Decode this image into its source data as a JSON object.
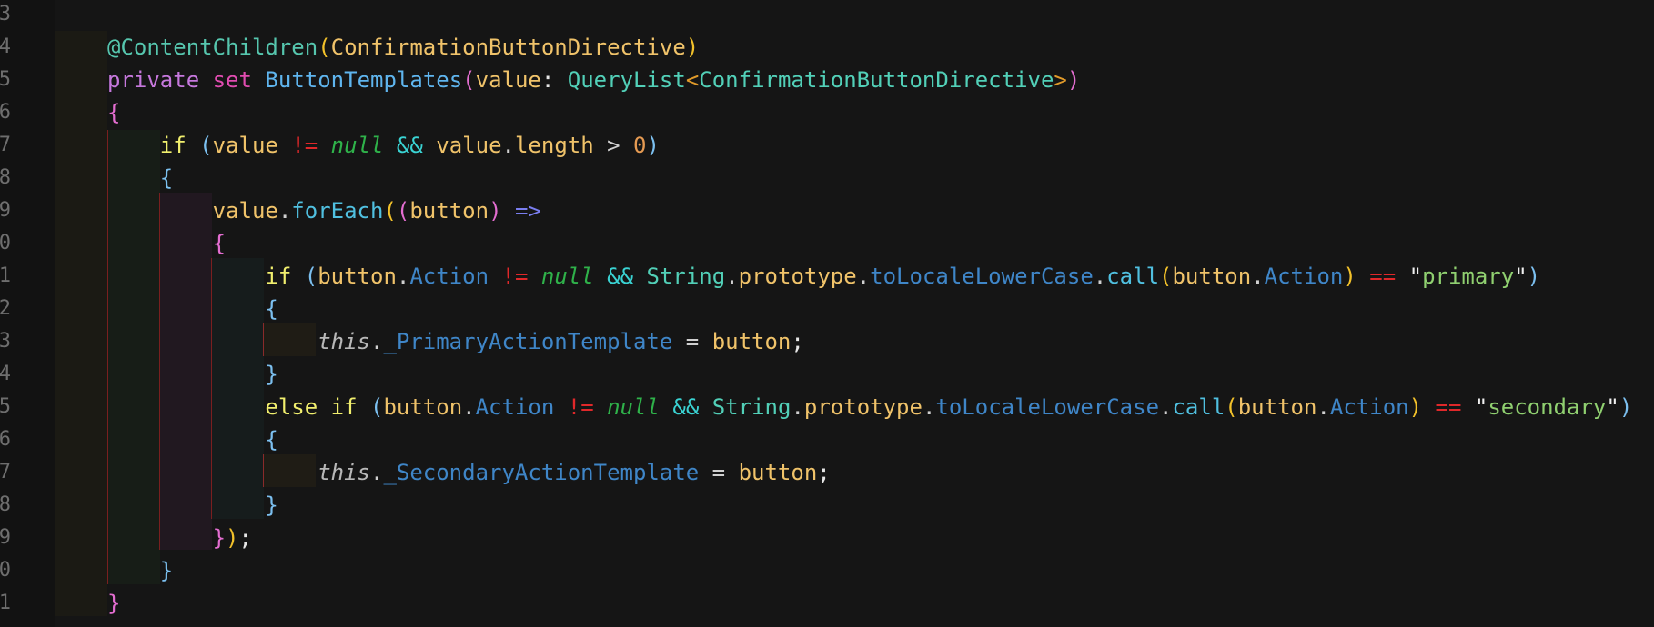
{
  "editor": {
    "line_numbers": [
      "3",
      "4",
      "5",
      "6",
      "7",
      "8",
      "9",
      "0",
      "1",
      "2",
      "3",
      "4",
      "5",
      "6",
      "7",
      "8",
      "9",
      "0",
      "1"
    ],
    "colors": {
      "background": "#151515",
      "keyword": "#c678dd",
      "string": "#90d070",
      "null_literal": "#2fb24a",
      "not_equal": "#e0282a"
    },
    "lines": [
      [],
      [
        {
          "t": "@ContentChildren",
          "c": "c-dec"
        },
        {
          "t": "(",
          "c": "c-br2"
        },
        {
          "t": "ConfirmationButtonDirective",
          "c": "c-var"
        },
        {
          "t": ")",
          "c": "c-br2"
        }
      ],
      [
        {
          "t": "private",
          "c": "c-kw"
        },
        {
          "t": " ",
          "c": "c-plain"
        },
        {
          "t": "set",
          "c": "c-kw2"
        },
        {
          "t": " ",
          "c": "c-plain"
        },
        {
          "t": "ButtonTemplates",
          "c": "c-fn"
        },
        {
          "t": "(",
          "c": "c-br0"
        },
        {
          "t": "value",
          "c": "c-var"
        },
        {
          "t": ": ",
          "c": "c-plain"
        },
        {
          "t": "QueryList",
          "c": "c-type"
        },
        {
          "t": "<",
          "c": "c-pn"
        },
        {
          "t": "ConfirmationButtonDirective",
          "c": "c-type"
        },
        {
          "t": ">",
          "c": "c-pn"
        },
        {
          "t": ")",
          "c": "c-br0"
        }
      ],
      [
        {
          "t": "{",
          "c": "c-br0"
        }
      ],
      [
        {
          "t": "    ",
          "c": "c-plain"
        },
        {
          "t": "if",
          "c": "c-ctl"
        },
        {
          "t": " ",
          "c": "c-plain"
        },
        {
          "t": "(",
          "c": "c-br1"
        },
        {
          "t": "value",
          "c": "c-var"
        },
        {
          "t": " ",
          "c": "c-plain"
        },
        {
          "t": "!=",
          "c": "c-neq"
        },
        {
          "t": " ",
          "c": "c-plain"
        },
        {
          "t": "null",
          "c": "c-null"
        },
        {
          "t": " ",
          "c": "c-plain"
        },
        {
          "t": "&&",
          "c": "c-and"
        },
        {
          "t": " ",
          "c": "c-plain"
        },
        {
          "t": "value",
          "c": "c-var"
        },
        {
          "t": ".",
          "c": "c-op"
        },
        {
          "t": "length",
          "c": "c-var"
        },
        {
          "t": " ",
          "c": "c-plain"
        },
        {
          "t": ">",
          "c": "c-op"
        },
        {
          "t": " ",
          "c": "c-plain"
        },
        {
          "t": "0",
          "c": "c-num"
        },
        {
          "t": ")",
          "c": "c-br1"
        }
      ],
      [
        {
          "t": "    ",
          "c": "c-plain"
        },
        {
          "t": "{",
          "c": "c-br1"
        }
      ],
      [
        {
          "t": "        ",
          "c": "c-plain"
        },
        {
          "t": "value",
          "c": "c-var"
        },
        {
          "t": ".",
          "c": "c-op"
        },
        {
          "t": "forEach",
          "c": "c-method"
        },
        {
          "t": "(",
          "c": "c-br2"
        },
        {
          "t": "(",
          "c": "c-br0"
        },
        {
          "t": "button",
          "c": "c-var"
        },
        {
          "t": ")",
          "c": "c-br0"
        },
        {
          "t": " ",
          "c": "c-plain"
        },
        {
          "t": "=>",
          "c": "c-arrow"
        }
      ],
      [
        {
          "t": "        ",
          "c": "c-plain"
        },
        {
          "t": "{",
          "c": "c-br0"
        }
      ],
      [
        {
          "t": "            ",
          "c": "c-plain"
        },
        {
          "t": "if",
          "c": "c-ctl"
        },
        {
          "t": " ",
          "c": "c-plain"
        },
        {
          "t": "(",
          "c": "c-br1"
        },
        {
          "t": "button",
          "c": "c-var"
        },
        {
          "t": ".",
          "c": "c-op"
        },
        {
          "t": "Action",
          "c": "c-prop"
        },
        {
          "t": " ",
          "c": "c-plain"
        },
        {
          "t": "!=",
          "c": "c-neq"
        },
        {
          "t": " ",
          "c": "c-plain"
        },
        {
          "t": "null",
          "c": "c-null"
        },
        {
          "t": " ",
          "c": "c-plain"
        },
        {
          "t": "&&",
          "c": "c-and"
        },
        {
          "t": " ",
          "c": "c-plain"
        },
        {
          "t": "String",
          "c": "c-type"
        },
        {
          "t": ".",
          "c": "c-op"
        },
        {
          "t": "prototype",
          "c": "c-var"
        },
        {
          "t": ".",
          "c": "c-op"
        },
        {
          "t": "toLocaleLowerCase",
          "c": "c-prop"
        },
        {
          "t": ".",
          "c": "c-op"
        },
        {
          "t": "call",
          "c": "c-method"
        },
        {
          "t": "(",
          "c": "c-br2"
        },
        {
          "t": "button",
          "c": "c-var"
        },
        {
          "t": ".",
          "c": "c-op"
        },
        {
          "t": "Action",
          "c": "c-prop"
        },
        {
          "t": ")",
          "c": "c-br2"
        },
        {
          "t": " ",
          "c": "c-plain"
        },
        {
          "t": "==",
          "c": "c-neq"
        },
        {
          "t": " ",
          "c": "c-plain"
        },
        {
          "t": "\"",
          "c": "c-quote"
        },
        {
          "t": "primary",
          "c": "c-str"
        },
        {
          "t": "\"",
          "c": "c-quote"
        },
        {
          "t": ")",
          "c": "c-br1"
        }
      ],
      [
        {
          "t": "            ",
          "c": "c-plain"
        },
        {
          "t": "{",
          "c": "c-br1"
        }
      ],
      [
        {
          "t": "                ",
          "c": "c-plain"
        },
        {
          "t": "this",
          "c": "c-this"
        },
        {
          "t": ".",
          "c": "c-op"
        },
        {
          "t": "_PrimaryActionTemplate",
          "c": "c-prop"
        },
        {
          "t": " ",
          "c": "c-plain"
        },
        {
          "t": "=",
          "c": "c-op"
        },
        {
          "t": " ",
          "c": "c-plain"
        },
        {
          "t": "button",
          "c": "c-var"
        },
        {
          "t": ";",
          "c": "c-plain"
        }
      ],
      [
        {
          "t": "            ",
          "c": "c-plain"
        },
        {
          "t": "}",
          "c": "c-br1"
        }
      ],
      [
        {
          "t": "            ",
          "c": "c-plain"
        },
        {
          "t": "else",
          "c": "c-ctl"
        },
        {
          "t": " ",
          "c": "c-plain"
        },
        {
          "t": "if",
          "c": "c-ctl"
        },
        {
          "t": " ",
          "c": "c-plain"
        },
        {
          "t": "(",
          "c": "c-br1"
        },
        {
          "t": "button",
          "c": "c-var"
        },
        {
          "t": ".",
          "c": "c-op"
        },
        {
          "t": "Action",
          "c": "c-prop"
        },
        {
          "t": " ",
          "c": "c-plain"
        },
        {
          "t": "!=",
          "c": "c-neq"
        },
        {
          "t": " ",
          "c": "c-plain"
        },
        {
          "t": "null",
          "c": "c-null"
        },
        {
          "t": " ",
          "c": "c-plain"
        },
        {
          "t": "&&",
          "c": "c-and"
        },
        {
          "t": " ",
          "c": "c-plain"
        },
        {
          "t": "String",
          "c": "c-type"
        },
        {
          "t": ".",
          "c": "c-op"
        },
        {
          "t": "prototype",
          "c": "c-var"
        },
        {
          "t": ".",
          "c": "c-op"
        },
        {
          "t": "toLocaleLowerCase",
          "c": "c-prop"
        },
        {
          "t": ".",
          "c": "c-op"
        },
        {
          "t": "call",
          "c": "c-method"
        },
        {
          "t": "(",
          "c": "c-br2"
        },
        {
          "t": "button",
          "c": "c-var"
        },
        {
          "t": ".",
          "c": "c-op"
        },
        {
          "t": "Action",
          "c": "c-prop"
        },
        {
          "t": ")",
          "c": "c-br2"
        },
        {
          "t": " ",
          "c": "c-plain"
        },
        {
          "t": "==",
          "c": "c-neq"
        },
        {
          "t": " ",
          "c": "c-plain"
        },
        {
          "t": "\"",
          "c": "c-quote"
        },
        {
          "t": "secondary",
          "c": "c-str"
        },
        {
          "t": "\"",
          "c": "c-quote"
        },
        {
          "t": ")",
          "c": "c-br1"
        }
      ],
      [
        {
          "t": "            ",
          "c": "c-plain"
        },
        {
          "t": "{",
          "c": "c-br1"
        }
      ],
      [
        {
          "t": "                ",
          "c": "c-plain"
        },
        {
          "t": "this",
          "c": "c-this"
        },
        {
          "t": ".",
          "c": "c-op"
        },
        {
          "t": "_SecondaryActionTemplate",
          "c": "c-prop"
        },
        {
          "t": " ",
          "c": "c-plain"
        },
        {
          "t": "=",
          "c": "c-op"
        },
        {
          "t": " ",
          "c": "c-plain"
        },
        {
          "t": "button",
          "c": "c-var"
        },
        {
          "t": ";",
          "c": "c-plain"
        }
      ],
      [
        {
          "t": "            ",
          "c": "c-plain"
        },
        {
          "t": "}",
          "c": "c-br1"
        }
      ],
      [
        {
          "t": "        ",
          "c": "c-plain"
        },
        {
          "t": "}",
          "c": "c-br0"
        },
        {
          "t": ")",
          "c": "c-br2"
        },
        {
          "t": ";",
          "c": "c-plain"
        }
      ],
      [
        {
          "t": "    ",
          "c": "c-plain"
        },
        {
          "t": "}",
          "c": "c-br1"
        }
      ],
      [
        {
          "t": "}",
          "c": "c-br0"
        }
      ]
    ]
  }
}
